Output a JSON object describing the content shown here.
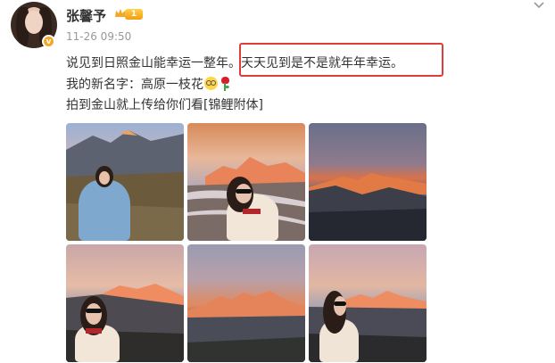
{
  "post": {
    "author_name": "张馨予",
    "level_badge": "1",
    "verified_badge": "v",
    "timestamp": "11-26 09:50",
    "lines": [
      "说见到日照金山能幸运一整年。天天见到是不是就年年幸运。",
      "我的新名字：高原一枝花",
      "拍到金山就上传给你们看[锦鲤附体]"
    ],
    "highlight_text": "天天见到是不是就年年幸运。",
    "emoji_smile": "smile-emoji",
    "emoji_flower": "rose-emoji",
    "photos": [
      {
        "icon": "photo-woman-blue-jacket-mountain"
      },
      {
        "icon": "photo-woman-sunglasses-golden-peak"
      },
      {
        "icon": "photo-golden-peak-sunset"
      },
      {
        "icon": "photo-woman-sunglasses-valley"
      },
      {
        "icon": "photo-golden-peak-ridge"
      },
      {
        "icon": "photo-woman-profile-peaks"
      }
    ]
  },
  "colors": {
    "highlight_border": "#e23b3b",
    "time_text": "#999999",
    "level_badge": "#f5a623"
  }
}
